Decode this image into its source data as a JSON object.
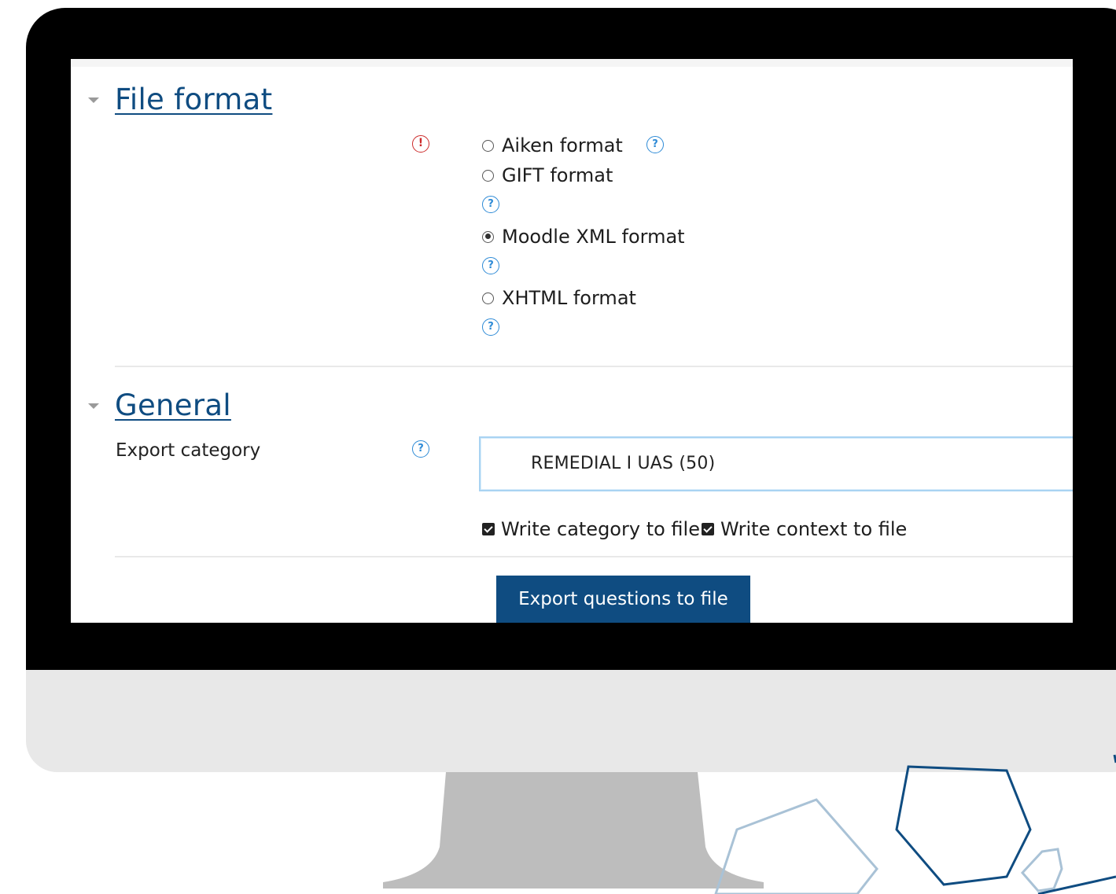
{
  "file_format_section": {
    "title": "File format",
    "options": [
      {
        "label": "Aiken format",
        "checked": false
      },
      {
        "label": "GIFT format",
        "checked": false
      },
      {
        "label": "Moodle XML format",
        "checked": true
      },
      {
        "label": "XHTML format",
        "checked": false
      }
    ]
  },
  "general_section": {
    "title": "General",
    "export_category_label": "Export category",
    "export_category_value": "REMEDIAL I UAS (50)",
    "write_category_label": "Write category to file",
    "write_category_checked": true,
    "write_context_label": "Write context to file",
    "write_context_checked": true
  },
  "actions": {
    "export_button_label": "Export questions to file"
  },
  "icons": {
    "help": "question-mark-circle-icon",
    "required": "exclamation-circle-icon",
    "collapse": "caret-down-icon"
  },
  "colors": {
    "link": "#0f4c81",
    "button": "#0f4c81",
    "help_icon": "#2d8ad6",
    "required_icon": "#cc2a2a",
    "monitor_bezel": "#000000",
    "monitor_chin": "#e8e8e8",
    "stand": "#bdbdbd"
  }
}
